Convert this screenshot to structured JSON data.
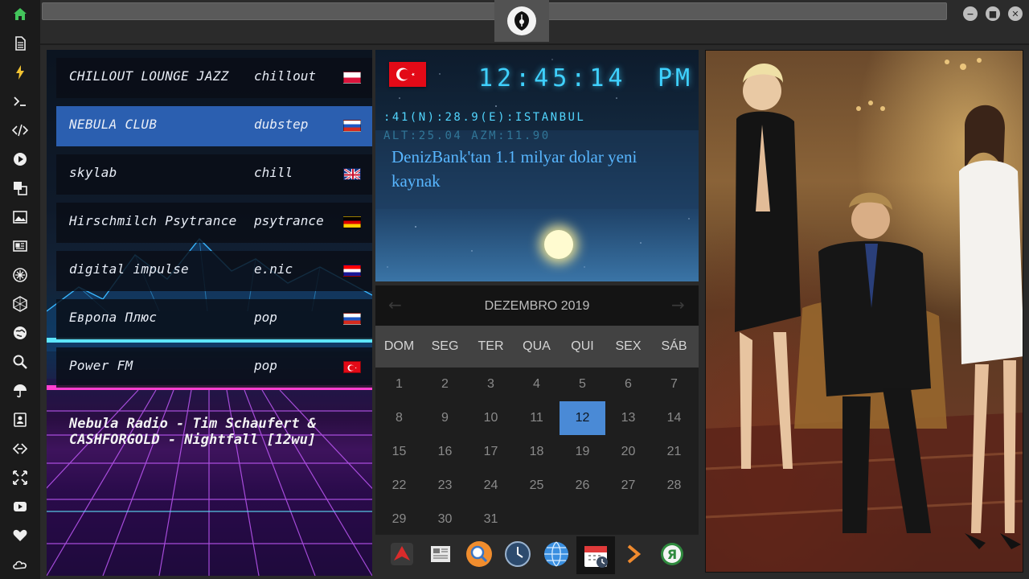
{
  "sidebar": {
    "icons": [
      "home-icon",
      "document-icon",
      "lightning-icon",
      "terminal-icon",
      "code-icon",
      "play-icon",
      "translate-icon",
      "image-icon",
      "news-icon",
      "rebel-icon",
      "hexagon-icon",
      "globe-icon",
      "search-icon",
      "umbrella-icon",
      "contacts-icon",
      "link-icon",
      "expand-icon",
      "youtube-icon",
      "heart-icon",
      "cloud-icon"
    ]
  },
  "topbar": {
    "emblem": "rebel-alliance-emblem",
    "window_buttons": [
      "minimize",
      "maximize",
      "close"
    ]
  },
  "radio": {
    "stations": [
      {
        "name": "CHILLOUT LOUNGE JAZZ",
        "genre": "chillout",
        "flag": "poland"
      },
      {
        "name": "NEBULA CLUB",
        "genre": "dubstep",
        "flag": "russia"
      },
      {
        "name": "skylab",
        "genre": "chill",
        "flag": "uk"
      },
      {
        "name": "Hirschmilch Psytrance",
        "genre": "psytrance",
        "flag": "germany"
      },
      {
        "name": "digital impulse",
        "genre": "e.nic",
        "flag": "croatia"
      },
      {
        "name": "Европа Плюс",
        "genre": "pop",
        "flag": "russia"
      },
      {
        "name": "Power FM",
        "genre": "pop",
        "flag": "turkey"
      }
    ],
    "active_index": 1,
    "now_playing": "Nebula Radio - Tim Schaufert & CASHFORGOLD - Nightfall [12wu]"
  },
  "clock": {
    "time": "12:45:14",
    "ampm": "PM",
    "coords": ":41(N):28.9(E):ISTANBUL",
    "altazm": "ALT:25.04 AZM:11.90",
    "news": "DenizBank'tan 1.1 milyar dolar yeni kaynak",
    "flag": "turkey"
  },
  "calendar": {
    "month": "DEZEMBRO 2019",
    "weekdays": [
      "DOM",
      "SEG",
      "TER",
      "QUA",
      "QUI",
      "SEX",
      "SÁB"
    ],
    "days": [
      "1",
      "2",
      "3",
      "4",
      "5",
      "6",
      "7",
      "8",
      "9",
      "10",
      "11",
      "12",
      "13",
      "14",
      "15",
      "16",
      "17",
      "18",
      "19",
      "20",
      "21",
      "22",
      "23",
      "24",
      "25",
      "26",
      "27",
      "28",
      "29",
      "30",
      "31"
    ],
    "today": "12",
    "prev_symbol": "←",
    "next_symbol": "→"
  },
  "dock": {
    "apps": [
      "arrow-app-icon",
      "newspaper-app-icon",
      "search-app-icon",
      "clock-app-icon",
      "globe-app-icon",
      "calendar-app-icon",
      "forward-app-icon",
      "yandex-app-icon"
    ],
    "active": "calendar-app-icon",
    "yandex_letter": "Я"
  },
  "colors": {
    "accent_blue": "#2b5fb0",
    "clock_cyan": "#3fd1ff",
    "news_blue": "#58b6ff",
    "today_blue": "#4a8ad6"
  }
}
